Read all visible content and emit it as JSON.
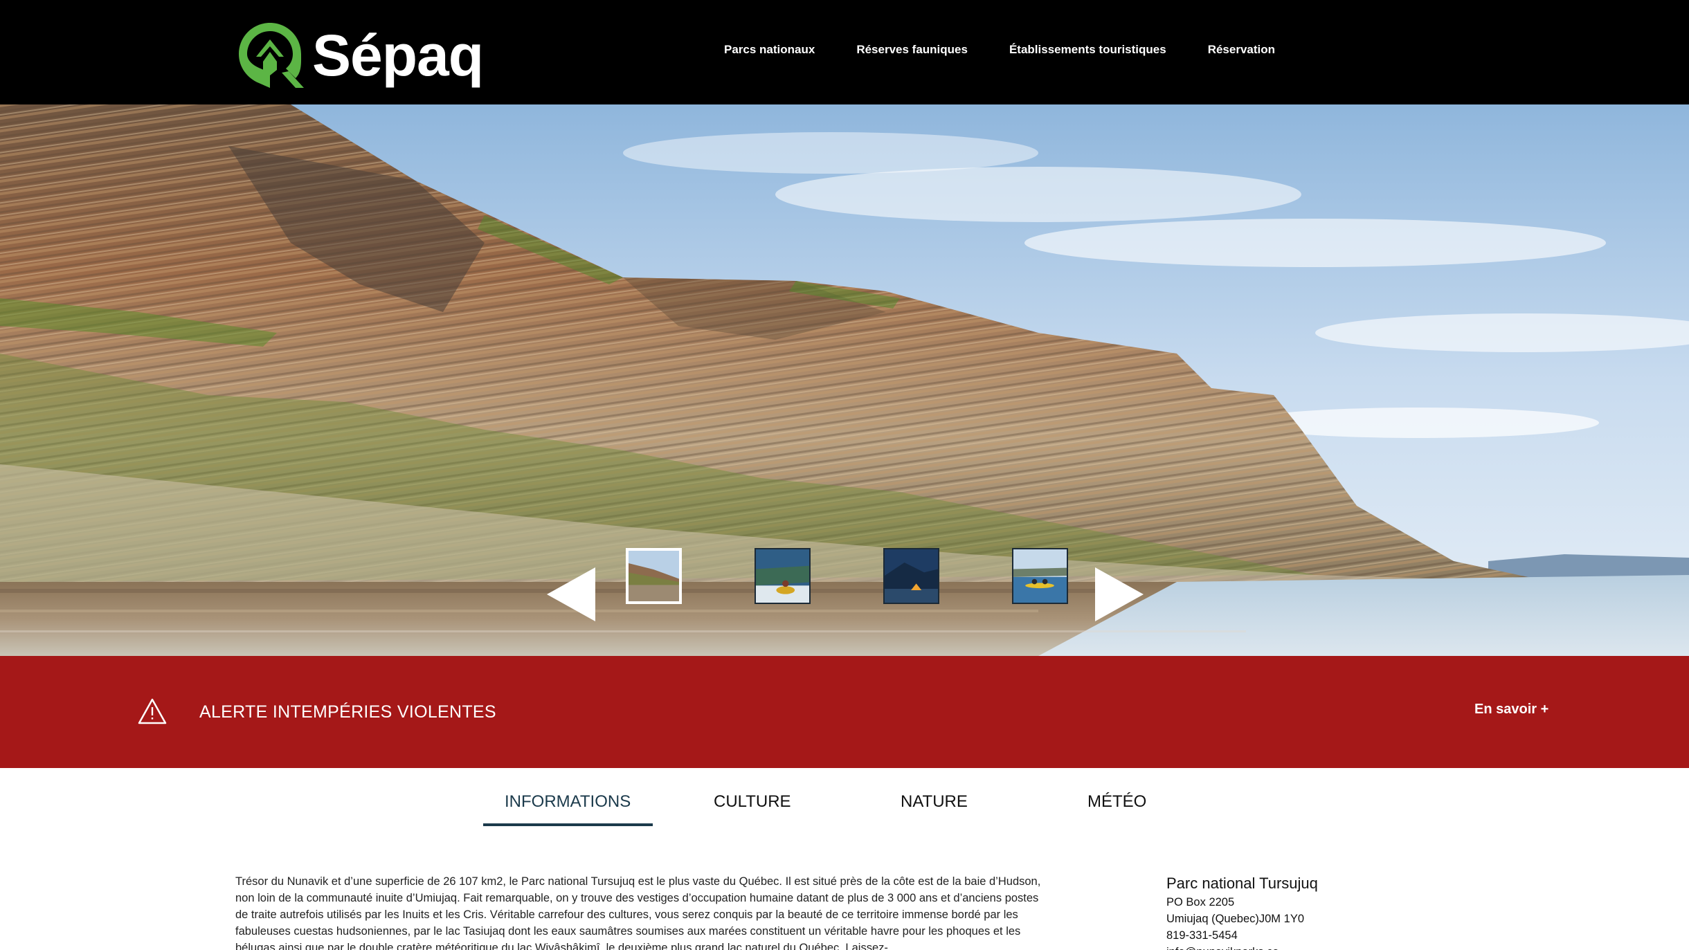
{
  "brand": {
    "name": "Sépaq",
    "logo_green": "#5cb545"
  },
  "nav": {
    "items": [
      {
        "label": "Parcs nationaux"
      },
      {
        "label": "Réserves fauniques"
      },
      {
        "label": "Établissements touristiques"
      },
      {
        "label": "Réservation"
      }
    ]
  },
  "carousel": {
    "thumbnails": [
      "cliffs-lake",
      "kayak-rapids",
      "tent-night",
      "kayak-blue"
    ],
    "active_index": 0
  },
  "alert": {
    "text": "ALERTE INTEMPÉRIES VIOLENTES",
    "link_label": "En savoir +",
    "color": "#a51818"
  },
  "tabs": {
    "items": [
      {
        "label": "INFORMATIONS"
      },
      {
        "label": "CULTURE"
      },
      {
        "label": "NATURE"
      },
      {
        "label": "MÉTÉO"
      }
    ],
    "active_index": 0
  },
  "main": {
    "description": "Trésor du Nunavik et d’une superficie de 26 107 km2, le Parc national Tursujuq est le plus vaste du Québec. Il est situé près de la côte est de la baie d’Hudson, non loin de la communauté inuite d’Umiujaq. Fait remarquable, on y trouve des vestiges d’occupation humaine datant de plus de 3 000 ans et d’anciens postes de traite autrefois utilisés par les Inuits et les Cris. Véritable carrefour des cultures, vous serez conquis par la beauté de ce territoire immense bordé par les fabuleuses cuestas hudsoniennes, par le lac Tasiujaq dont les eaux saumâtres soumises aux marées constituent un véritable havre pour les phoques et les bélugas ainsi que par le double cratère météoritique du lac Wiyâshâkimî, le deuxième plus grand lac naturel du Québec. Laissez-"
  },
  "contact": {
    "park_name": "Parc national Tursujuq",
    "po_box": "PO Box 2205",
    "address": "Umiujaq (Quebec)J0M 1Y0",
    "phone": "819-331-5454",
    "email": "info@nunavikparks.ca"
  }
}
